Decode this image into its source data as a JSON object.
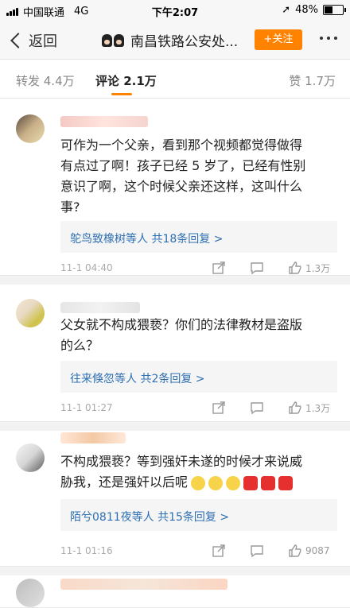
{
  "status": {
    "carrier": "中国联通",
    "network": "4G",
    "time": "下午2:07",
    "battery": "48%",
    "battery_level": 0.48
  },
  "nav": {
    "back": "返回",
    "title": "南昌铁路公安处...",
    "follow": "+关注"
  },
  "tabs": [
    {
      "label": "转发 4.4万"
    },
    {
      "label": "评论 2.1万"
    },
    {
      "label": "赞 1.7万"
    }
  ],
  "comments": [
    {
      "text": "可作为一个父亲，看到那个视频都觉得做得\n有点过了啊！孩子已经 5 岁了，已经有性别\n意识了啊，这个时候父亲还这样，这叫什么\n事?",
      "replies": "鸵鸟致橡树等人  共18条回复 >",
      "time": "11-1 04:40",
      "likes": "1.3万"
    },
    {
      "text": "父女就不构成猥亵？你们的法律教材是盗版\n的么？",
      "replies": "往来倏忽等人  共2条回复 >",
      "time": "11-1 01:27",
      "likes": "1.3万"
    },
    {
      "text": "不构成猥亵？等到强奸未遂的时候才来说威\n胁我，还是强奸以后呢",
      "replies": "陌兮0811夜等人  共15条回复 >",
      "time": "11-1 01:16",
      "likes": "9087"
    }
  ],
  "colors": {
    "accent": "#ff8200",
    "link": "#2e6fb3"
  },
  "icons": [
    "signal-icon",
    "battery-icon",
    "location-icon",
    "chevron-left-icon",
    "police-icon",
    "more-icon",
    "share-icon",
    "comment-icon",
    "like-icon",
    "smile-emoji-icon",
    "gift-emoji-icon"
  ]
}
